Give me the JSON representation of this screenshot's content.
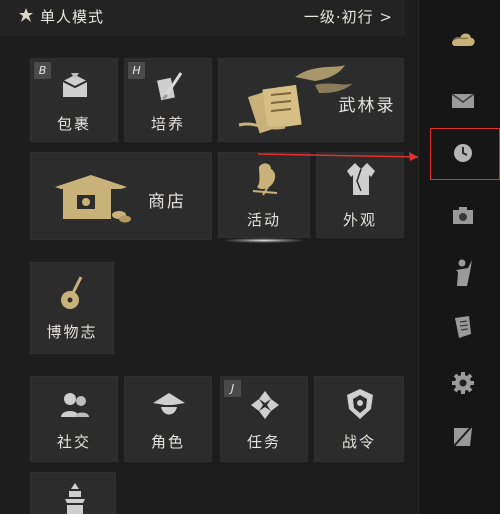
{
  "header": {
    "mode_label": "单人模式",
    "level_label": "一级·初行 >"
  },
  "tiles": {
    "package": {
      "label": "包裹",
      "hotkey": "B"
    },
    "train": {
      "label": "培养",
      "hotkey": "H"
    },
    "wulin": {
      "label": "武林录"
    },
    "shop": {
      "label": "商店"
    },
    "activity": {
      "label": "活动"
    },
    "appearance": {
      "label": "外观"
    },
    "museum": {
      "label": "博物志"
    },
    "social": {
      "label": "社交"
    },
    "role": {
      "label": "角色"
    },
    "task": {
      "label": "任务",
      "hotkey": "J"
    },
    "battlepass": {
      "label": "战令"
    }
  },
  "sidebar": {
    "items": [
      "cloud-icon",
      "mail-icon",
      "clock-icon",
      "camera-icon",
      "figure-icon",
      "scroll-icon",
      "gear-icon",
      "flag-icon"
    ],
    "highlighted": "clock-icon"
  },
  "colors": {
    "gold": "#c9b27a",
    "highlight": "#e03030",
    "tile_bg": "#2c2c2c"
  }
}
